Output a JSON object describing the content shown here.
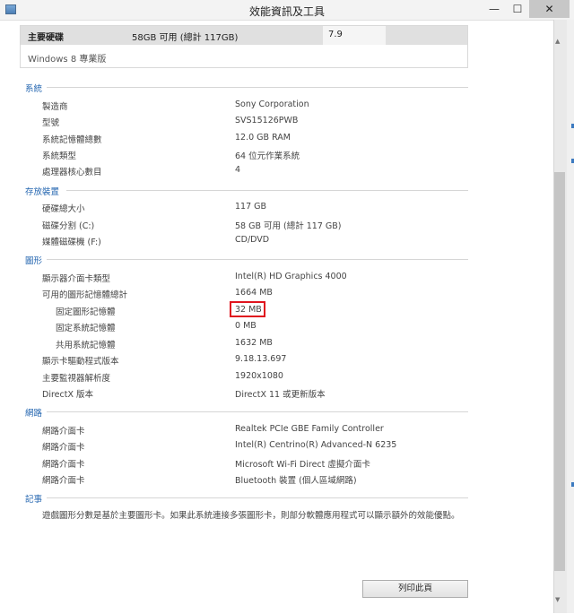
{
  "window": {
    "title": "效能資訊及工具",
    "min_glyph": "—",
    "max_glyph": "☐",
    "close_glyph": "✕"
  },
  "rating": {
    "label": "主要硬碟",
    "value": "58GB 可用 (總計 117GB)",
    "score": "7.9",
    "edition": "Windows 8 專業版"
  },
  "sections": {
    "system": {
      "title": "系統",
      "rows": [
        {
          "label": "製造商",
          "value": "Sony Corporation"
        },
        {
          "label": "型號",
          "value": "SVS15126PWB"
        },
        {
          "label": "系統記憶體總數",
          "value": "12.0 GB RAM"
        },
        {
          "label": "系統類型",
          "value": "64 位元作業系統"
        },
        {
          "label": "處理器核心數目",
          "value": "4"
        }
      ]
    },
    "storage": {
      "title": "存放裝置",
      "rows": [
        {
          "label": "硬碟總大小",
          "value": "117 GB"
        },
        {
          "label": "磁碟分割 (C:)",
          "value": "58 GB 可用 (總計 117 GB)"
        },
        {
          "label": "媒體磁碟機 (F:)",
          "value": "CD/DVD"
        }
      ]
    },
    "graphics": {
      "title": "圖形",
      "rows": [
        {
          "label": "顯示器介面卡類型",
          "value": "Intel(R) HD Graphics 4000"
        },
        {
          "label": "可用的圖形記憶體總計",
          "value": "1664 MB"
        },
        {
          "label": "固定圖形記憶體",
          "value": "32 MB"
        },
        {
          "label": "固定系統記憶體",
          "value": "0 MB"
        },
        {
          "label": "共用系統記憶體",
          "value": "1632 MB"
        },
        {
          "label": "顯示卡驅動程式版本",
          "value": "9.18.13.697"
        },
        {
          "label": "主要監視器解析度",
          "value": "1920x1080"
        },
        {
          "label": "DirectX 版本",
          "value": "DirectX 11 或更新版本"
        }
      ]
    },
    "network": {
      "title": "網路",
      "rows": [
        {
          "label": "網路介面卡",
          "value": "Realtek PCIe GBE Family Controller"
        },
        {
          "label": "網路介面卡",
          "value": "Intel(R) Centrino(R) Advanced-N 6235"
        },
        {
          "label": "網路介面卡",
          "value": "Microsoft Wi-Fi Direct 虛擬介面卡"
        },
        {
          "label": "網路介面卡",
          "value": "Bluetooth 裝置 (個人區域網路)"
        }
      ]
    },
    "notes": {
      "title": "記事",
      "text": "遊戲圖形分數是基於主要圖形卡。如果此系統連接多張圖形卡，則部分軟體應用程式可以顯示額外的效能優點。"
    }
  },
  "actions": {
    "print_label": "列印此頁"
  }
}
